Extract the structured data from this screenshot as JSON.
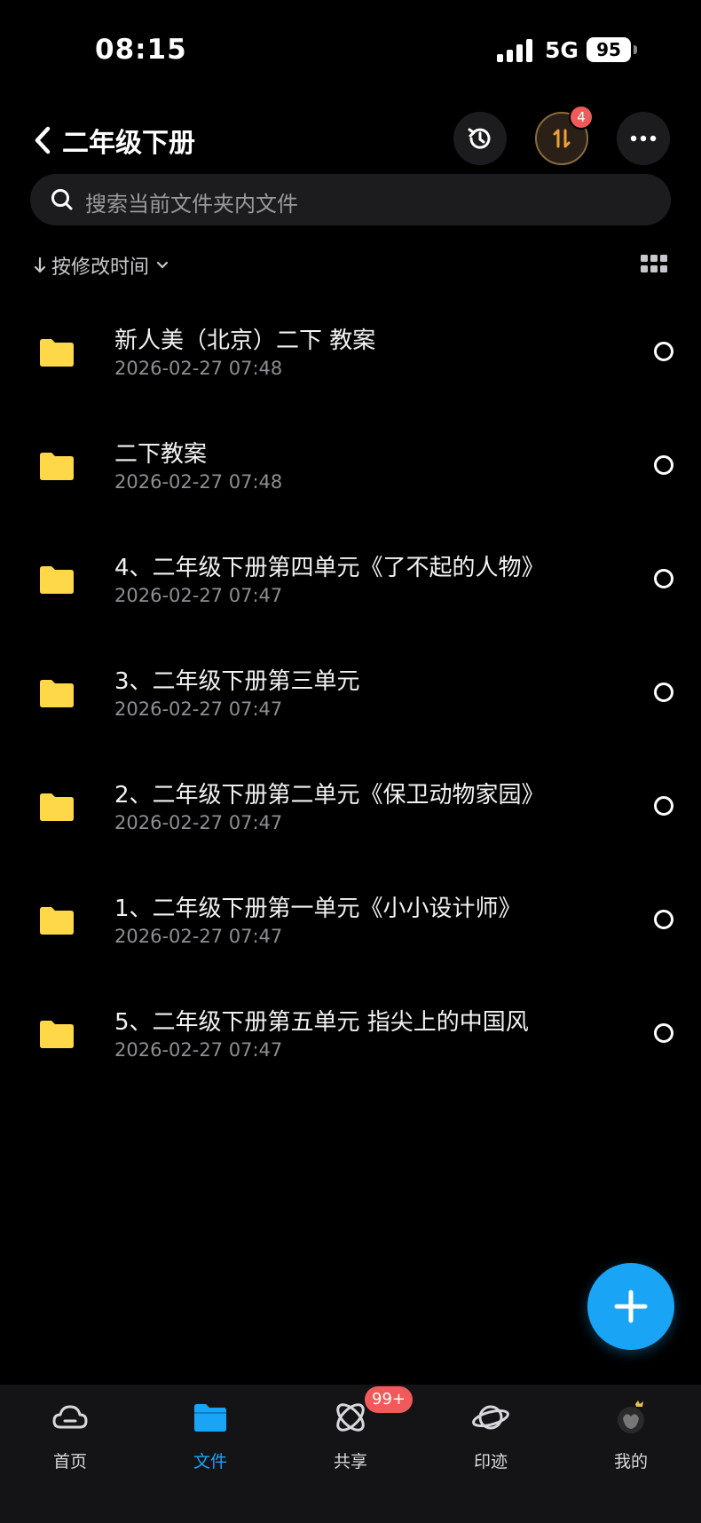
{
  "status_bar": {
    "time": "08:15",
    "network": "5G",
    "battery": "95"
  },
  "header": {
    "title": "二年级下册",
    "transfer_badge": "4"
  },
  "search": {
    "placeholder": "搜索当前文件夹内文件"
  },
  "sort": {
    "label": "按修改时间"
  },
  "files": [
    {
      "name": "新人美（北京）二下 教案",
      "date": "2026-02-27 07:48"
    },
    {
      "name": "二下教案",
      "date": "2026-02-27 07:48"
    },
    {
      "name": "4、二年级下册第四单元《了不起的人物》",
      "date": "2026-02-27 07:47"
    },
    {
      "name": "3、二年级下册第三单元",
      "date": "2026-02-27 07:47"
    },
    {
      "name": "2、二年级下册第二单元《保卫动物家园》",
      "date": "2026-02-27 07:47"
    },
    {
      "name": "1、二年级下册第一单元《小小设计师》",
      "date": "2026-02-27 07:47"
    },
    {
      "name": "5、二年级下册第五单元 指尖上的中国风",
      "date": "2026-02-27 07:47"
    }
  ],
  "tabs": [
    {
      "label": "首页",
      "icon": "cloud-icon"
    },
    {
      "label": "文件",
      "icon": "folder-icon"
    },
    {
      "label": "共享",
      "icon": "share-atom-icon"
    },
    {
      "label": "印迹",
      "icon": "planet-icon"
    },
    {
      "label": "我的",
      "icon": "avatar-icon"
    }
  ],
  "share_badge": "99+",
  "colors": {
    "accent": "#1aa4f5",
    "folder": "#ffd84a",
    "badge": "#f05a5a",
    "background": "#000000"
  }
}
